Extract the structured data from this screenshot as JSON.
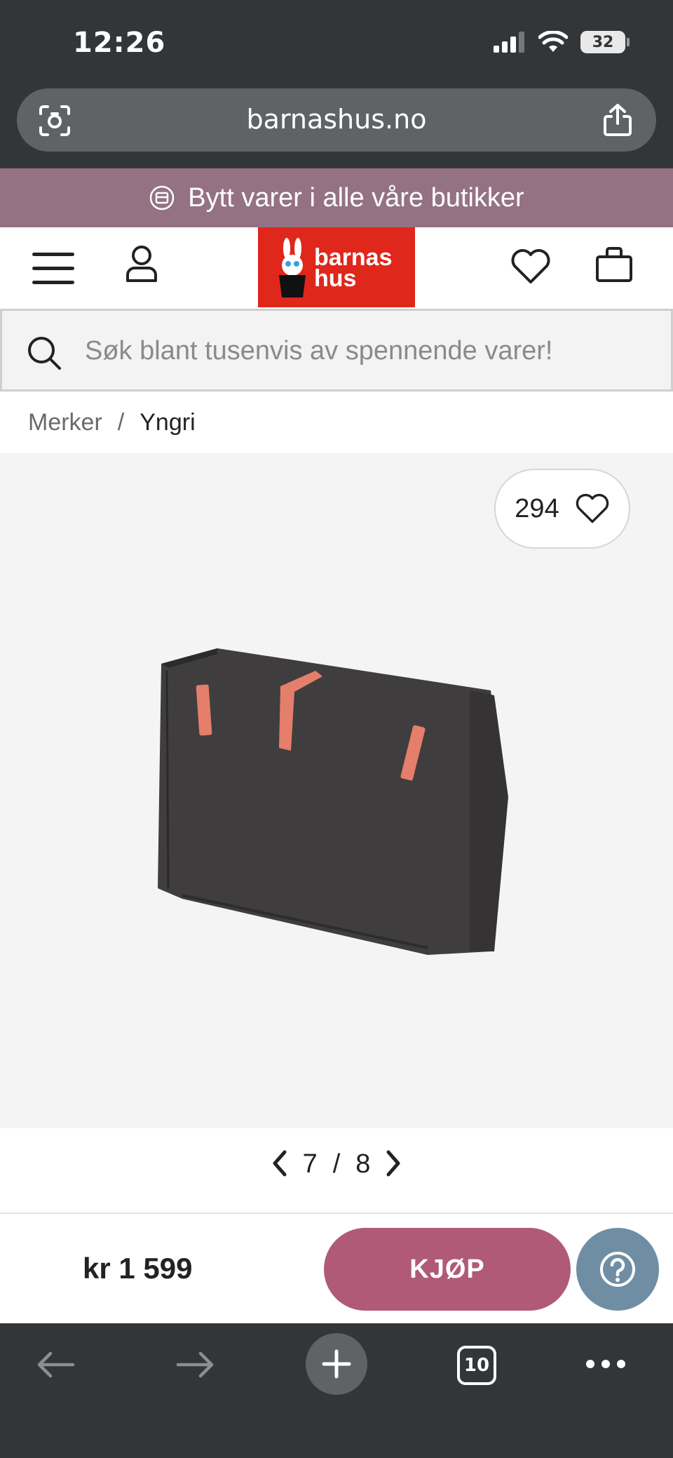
{
  "status_bar": {
    "time": "12:26",
    "battery": "32"
  },
  "browser": {
    "url": "barnashus.no",
    "tab_count": "10"
  },
  "promo_banner": {
    "text": "Bytt varer i alle våre butikker"
  },
  "header": {
    "logo_line1": "barnas",
    "logo_line2": "hus"
  },
  "search": {
    "placeholder": "Søk blant tusenvis av spennende varer!"
  },
  "breadcrumb": {
    "items": [
      "Merker",
      "Yngri"
    ],
    "separator": "/"
  },
  "product": {
    "favorite_count": "294",
    "image_index": "7",
    "image_total": "8",
    "pager_separator": "/"
  },
  "buy_bar": {
    "price": "kr 1 599",
    "buy_label": "KJØP"
  },
  "colors": {
    "promo": "#947284",
    "logo": "#e0271c",
    "buy": "#b05a78",
    "help": "#6f8ea3",
    "chrome": "#333638"
  },
  "icons": [
    "menu-icon",
    "user-icon",
    "heart-icon",
    "bag-icon",
    "search-icon",
    "camera-icon",
    "share-icon",
    "exchange-icon",
    "chevron-left-icon",
    "chevron-right-icon",
    "help-icon",
    "back-icon",
    "forward-icon",
    "plus-icon",
    "more-icon"
  ]
}
